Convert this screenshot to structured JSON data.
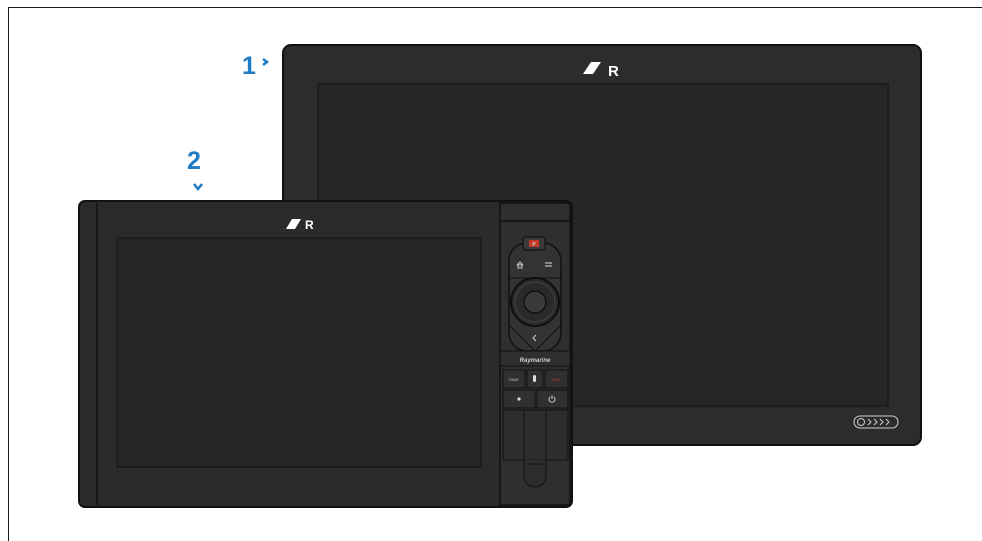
{
  "callouts": {
    "display_1": "1",
    "display_2": "2"
  },
  "brand": {
    "logo_letter": "R",
    "control_brand_text": "Raymarine"
  },
  "keypad": {
    "pilot_key": "P",
    "home_icon": "home-icon",
    "menu_icon": "menu-icon",
    "back_icon": "back-chevron-icon",
    "power_icon": "power-icon",
    "mob_key_label": "MOB",
    "left_key_label": "PAGE"
  },
  "colors": {
    "callout": "#1e7bc4",
    "bezel": "#2b2b2b",
    "screen": "#242424",
    "pilot_accent": "#c0392b"
  }
}
